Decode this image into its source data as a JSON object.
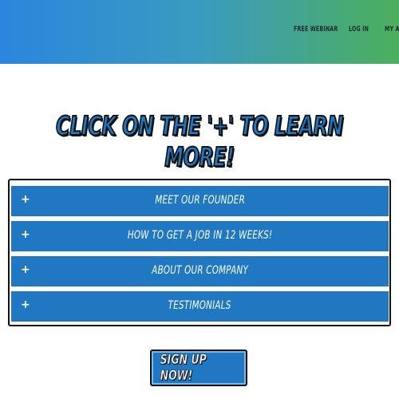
{
  "header": {
    "nav": {
      "webinar": "FREE WEBINAR",
      "login": "LOG IN",
      "my_account": "MY ACCOUNT"
    },
    "gradient_start": "#2a86de",
    "gradient_end": "#4caf5c"
  },
  "hero": {
    "title": "CLICK ON THE '+' TO LEARN MORE!"
  },
  "accordion": {
    "items": [
      {
        "icon": "+",
        "label": "MEET OUR FOUNDER"
      },
      {
        "icon": "+",
        "label": "HOW TO GET A JOB IN 12 WEEKS!"
      },
      {
        "icon": "+",
        "label": "ABOUT OUR COMPANY"
      },
      {
        "icon": "+",
        "label": "TESTIMONIALS"
      }
    ]
  },
  "cta": {
    "signup_label": "SIGN UP NOW!"
  },
  "colors": {
    "accent_blue": "#1f78c1",
    "outline": "#111111"
  }
}
